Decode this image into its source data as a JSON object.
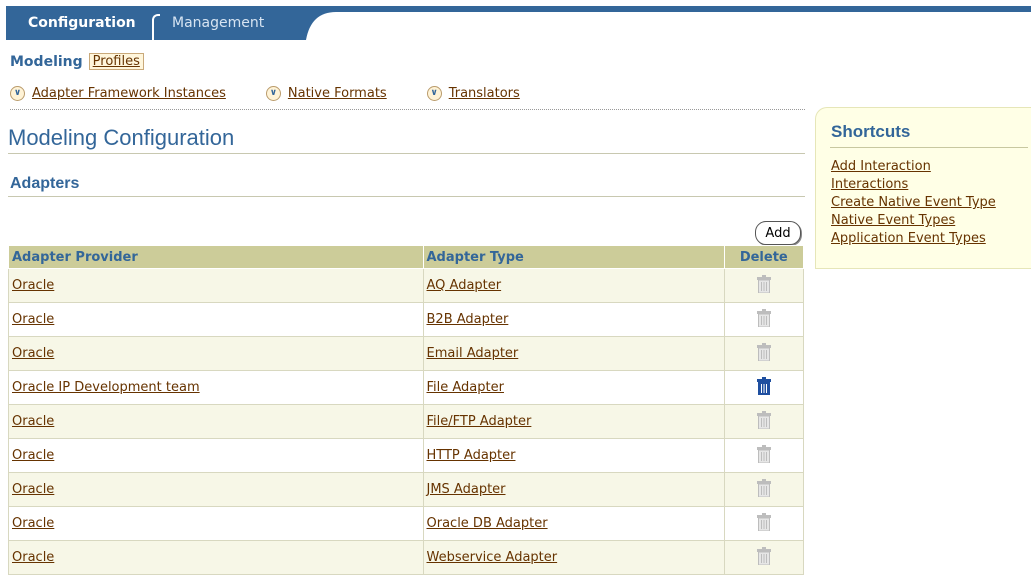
{
  "tabs": {
    "active": "Configuration",
    "inactive": "Management"
  },
  "subtabs": {
    "active": "Modeling",
    "other": "Profiles"
  },
  "quick_links": [
    "Adapter Framework Instances",
    "Native Formats",
    "Translators"
  ],
  "page_title": "Modeling Configuration",
  "section_title": "Adapters",
  "add_label": "Add",
  "table": {
    "headers": [
      "Adapter Provider",
      "Adapter Type",
      "Delete"
    ],
    "rows": [
      {
        "provider": "Oracle",
        "type": "AQ Adapter",
        "delete_active": false
      },
      {
        "provider": "Oracle",
        "type": "B2B Adapter",
        "delete_active": false
      },
      {
        "provider": "Oracle",
        "type": "Email Adapter",
        "delete_active": false
      },
      {
        "provider": "Oracle IP Development team",
        "type": "File Adapter",
        "delete_active": true
      },
      {
        "provider": "Oracle",
        "type": "File/FTP Adapter",
        "delete_active": false
      },
      {
        "provider": "Oracle",
        "type": "HTTP Adapter",
        "delete_active": false
      },
      {
        "provider": "Oracle",
        "type": "JMS Adapter",
        "delete_active": false
      },
      {
        "provider": "Oracle",
        "type": "Oracle DB Adapter",
        "delete_active": false
      },
      {
        "provider": "Oracle",
        "type": "Webservice Adapter",
        "delete_active": false
      }
    ]
  },
  "shortcuts": {
    "title": "Shortcuts",
    "links": [
      "Add Interaction",
      "Interactions",
      "Create Native Event Type",
      "Native Event Types",
      "Application Event Types"
    ]
  },
  "colors": {
    "brand": "#336699",
    "header_bg": "#cccc99",
    "link": "#663300",
    "trash_active": "#1f4fa0",
    "trash_inactive": "#bdbdbd"
  }
}
